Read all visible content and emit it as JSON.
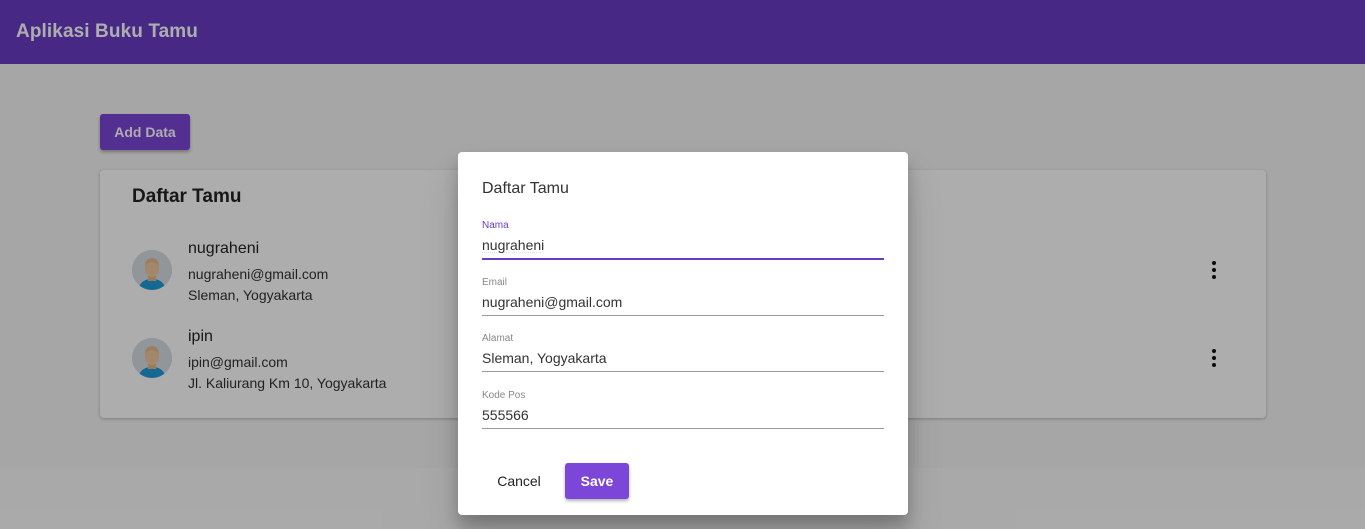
{
  "app": {
    "title": "Aplikasi Buku Tamu"
  },
  "toolbar": {
    "add_label": "Add Data"
  },
  "colors": {
    "primary": "#6a3cc4",
    "button": "#7c46d8",
    "focus_underline": "#6a3cc4"
  },
  "list": {
    "title": "Daftar Tamu",
    "items": [
      {
        "name": "nugraheni",
        "email": "nugraheni@gmail.com",
        "address": "Sleman, Yogyakarta",
        "avatar": "person-avatar",
        "menu_icon": "more-vert-icon"
      },
      {
        "name": "ipin",
        "email": "ipin@gmail.com",
        "address": "Jl. Kaliurang Km 10, Yogyakarta",
        "avatar": "person-avatar",
        "menu_icon": "more-vert-icon"
      }
    ]
  },
  "dialog": {
    "title": "Daftar Tamu",
    "fields": {
      "nama": {
        "label": "Nama",
        "value": "nugraheni"
      },
      "email": {
        "label": "Email",
        "value": "nugraheni@gmail.com"
      },
      "alamat": {
        "label": "Alamat",
        "value": "Sleman, Yogyakarta"
      },
      "kode_pos": {
        "label": "Kode Pos",
        "value": "555566"
      }
    },
    "cancel_label": "Cancel",
    "save_label": "Save"
  }
}
